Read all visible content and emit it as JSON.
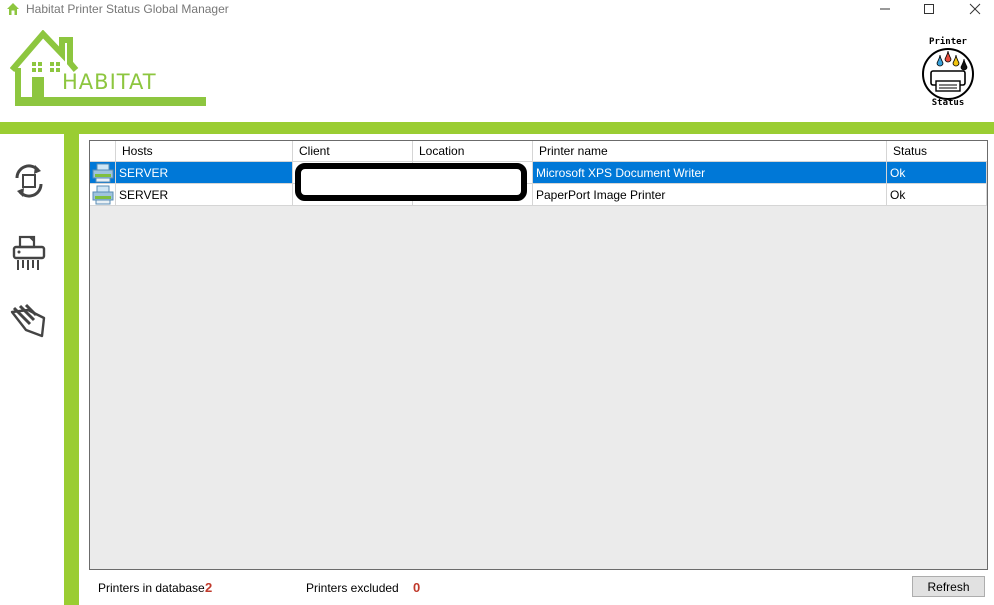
{
  "window": {
    "title": "Habitat Printer Status Global Manager",
    "icon": "house-icon",
    "controls": [
      "minimize-icon",
      "maximize-icon",
      "close-icon"
    ]
  },
  "header": {
    "logo_text": "HABITAT",
    "status_logo": {
      "top": "Printer",
      "bottom": "Status"
    }
  },
  "colors": {
    "brand_green": "#9acd32",
    "selection_blue": "#0078d7",
    "count_red": "#c0392b"
  },
  "sidebar": {
    "items": [
      {
        "icon": "sync-icon"
      },
      {
        "icon": "printer-shredder-icon"
      },
      {
        "icon": "exclude-hand-icon"
      }
    ]
  },
  "grid": {
    "columns": [
      "Hosts",
      "Client",
      "Location",
      "Printer name",
      "Status"
    ],
    "rows": [
      {
        "host": "SERVER",
        "client": "",
        "location": "",
        "printer": "Microsoft XPS Document Writer",
        "status": "Ok",
        "selected": true
      },
      {
        "host": "SERVER",
        "client": "",
        "location": "",
        "printer": "PaperPort Image Printer",
        "status": "Ok",
        "selected": false
      }
    ]
  },
  "footer": {
    "printers_in_database_label": "Printers in database",
    "printers_in_database_value": "2",
    "printers_excluded_label": "Printers excluded",
    "printers_excluded_value": "0",
    "refresh_label": "Refresh"
  }
}
